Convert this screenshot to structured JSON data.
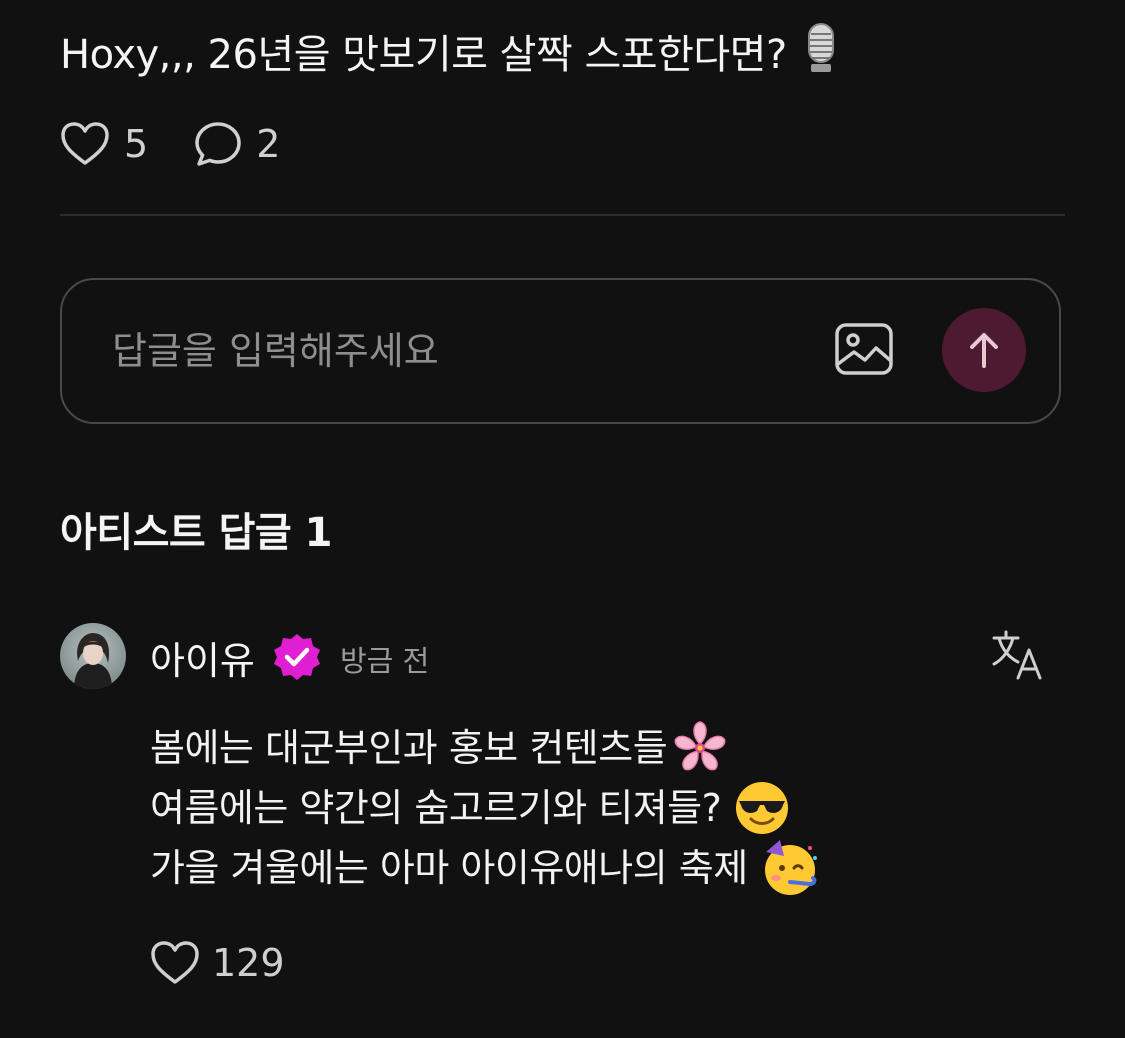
{
  "post": {
    "text": "Hoxy,,, 26년을 맛보기로 살짝 스포한다면?",
    "like_count": "5",
    "comment_count": "2"
  },
  "reply_box": {
    "placeholder": "답글을 입력해주세요"
  },
  "artist_replies": {
    "title": "아티스트 답글 1",
    "comments": [
      {
        "author": "아이유",
        "timestamp": "방금 전",
        "lines": [
          "봄에는 대군부인과 홍보 컨텐츠들",
          "여름에는 약간의 숨고르기와 티져들?",
          "가을 겨울에는 아마 아이유애나의 축제"
        ],
        "like_count": "129"
      }
    ]
  },
  "icons": {
    "post_emoji": "microphone-icon",
    "like": "heart-outline-icon",
    "comment": "speech-bubble-icon",
    "image": "image-icon",
    "send": "arrow-up-icon",
    "verified": "verified-badge-icon",
    "translate": "translate-icon",
    "line_emojis": [
      "cherry-blossom-icon",
      "sunglasses-face-icon",
      "partying-face-icon"
    ]
  },
  "colors": {
    "background": "#111111",
    "send_button": "#4d1a32",
    "verified_badge": "#e11fd2",
    "muted_text": "#9a9a9a"
  }
}
